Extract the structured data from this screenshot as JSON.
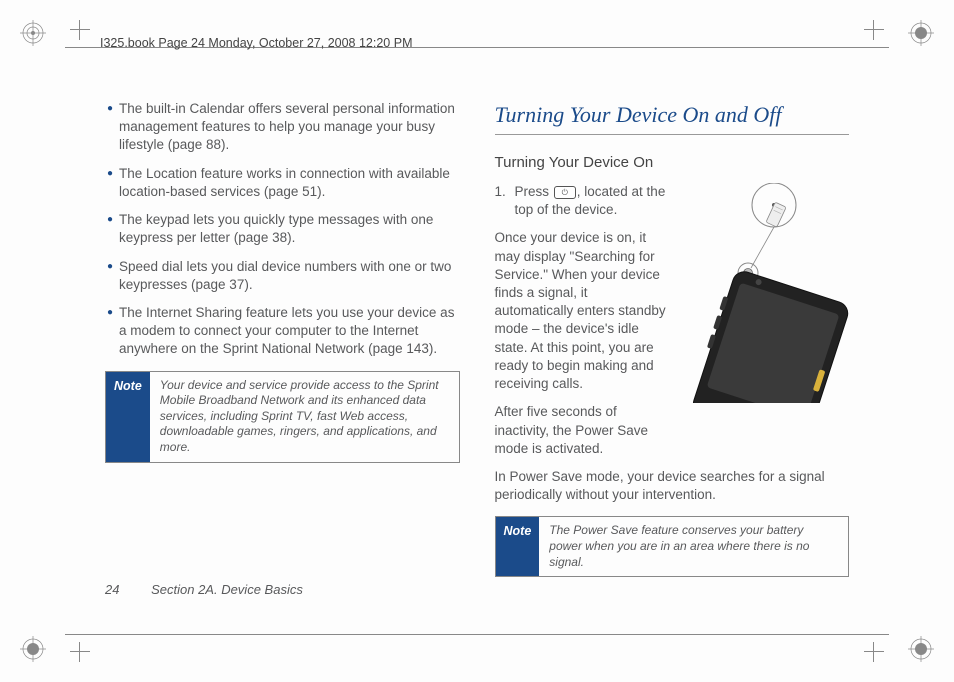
{
  "header": "I325.book  Page 24  Monday, October 27, 2008  12:20 PM",
  "left": {
    "bullets": [
      "The built-in Calendar offers several personal information management features to help you manage your busy lifestyle (page 88).",
      "The Location feature works in connection with available location-based services (page 51).",
      "The keypad lets you quickly type messages with one keypress per letter (page 38).",
      "Speed dial lets you dial device numbers with one or two keypresses (page 37).",
      "The Internet Sharing feature lets you use your device as a modem to connect your computer to the Internet anywhere on the Sprint National Network (page 143)."
    ],
    "note_label": "Note",
    "note_body": "Your device and service provide access to the Sprint Mobile Broadband Network and its enhanced data services, including Sprint TV, fast Web access, downloadable games, ringers, and applications, and more."
  },
  "right": {
    "title": "Turning Your Device On and Off",
    "subtitle": "Turning Your Device On",
    "step_num": "1.",
    "step_pre": "Press ",
    "step_post": ", located at the top of the device.",
    "para1": "Once your device is on, it may display \"Searching for Service.\" When your device finds a signal, it automatically enters standby mode – the device's idle state. At this point, you are ready to begin making and receiving calls.",
    "para2": "After five seconds of inactivity, the Power Save mode is activated.",
    "para3": "In Power Save mode, your device searches for a signal periodically without your intervention.",
    "note_label": "Note",
    "note_body": "The Power Save feature conserves your battery power when you are in an area where there is no signal."
  },
  "footer": {
    "page": "24",
    "section": "Section 2A. Device Basics"
  }
}
